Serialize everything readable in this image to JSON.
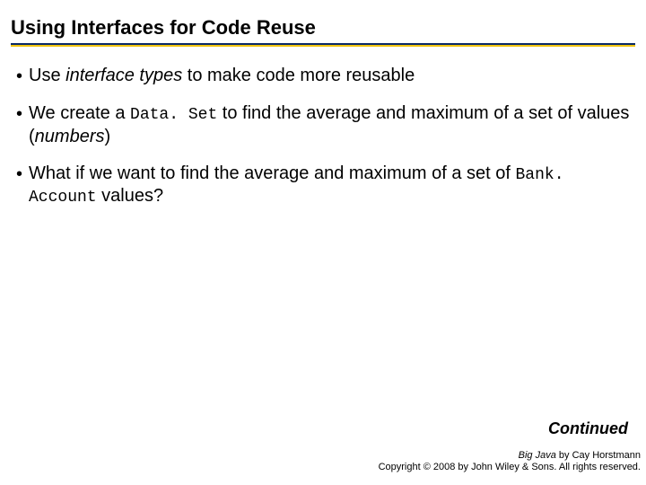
{
  "title": "Using Interfaces for Code Reuse",
  "bullets": {
    "b1": {
      "pre": "Use ",
      "it": "interface types",
      "post": " to make code more reusable"
    },
    "b2": {
      "a": "We create a ",
      "code": "Data. Set",
      "b": " to find the average and maximum of a set of values (",
      "it": "numbers",
      "c": ")"
    },
    "b3": {
      "a": "What if we want to find the average and maximum of a set of ",
      "code": "Bank. Account",
      "b": " values?"
    }
  },
  "continued": "Continued",
  "footer": {
    "book": "Big Java",
    "byline": " by Cay Horstmann",
    "copyright": "Copyright © 2008 by John Wiley & Sons.  All rights reserved."
  }
}
